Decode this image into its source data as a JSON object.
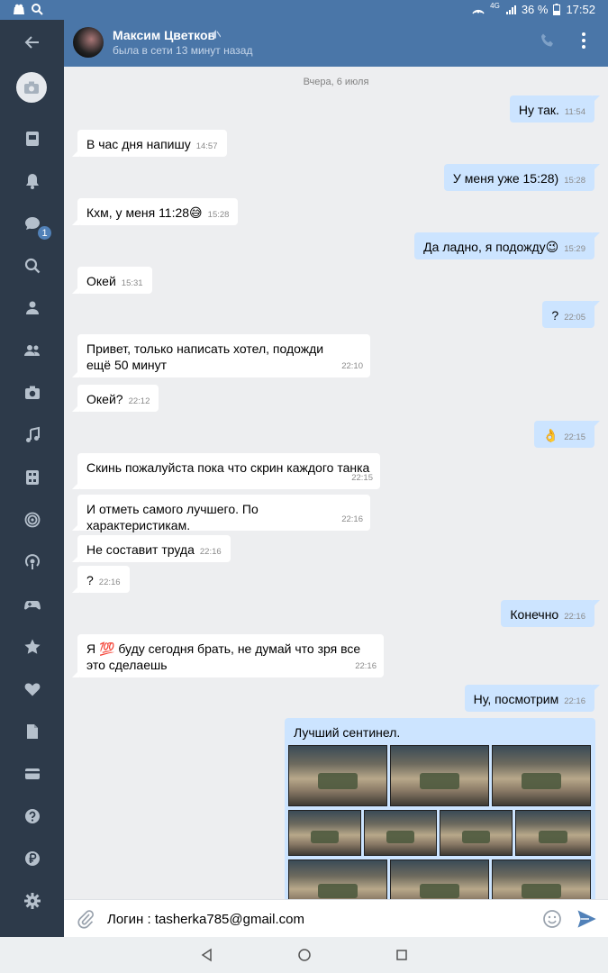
{
  "status_bar": {
    "battery": "36 %",
    "time": "17:52",
    "network": "4G"
  },
  "header": {
    "name": "Максим Цветков",
    "status": "была в сети 13 минут назад"
  },
  "sidebar": {
    "unread_badge": "1"
  },
  "chat": {
    "date_separator": "Вчера, 6 июля",
    "messages": [
      {
        "dir": "out",
        "text": "Ну так.",
        "time": "11:54"
      },
      {
        "dir": "in",
        "text": "В час дня напишу",
        "time": "14:57"
      },
      {
        "dir": "out",
        "text": "У меня уже 15:28)",
        "time": "15:28"
      },
      {
        "dir": "in",
        "text": "Кхм, у меня 11:28😅",
        "time": "15:28"
      },
      {
        "dir": "out",
        "text": "Да ладно, я подожду😉",
        "time": "15:29"
      },
      {
        "dir": "in",
        "text": "Окей",
        "time": "15:31"
      },
      {
        "dir": "out",
        "text": "?",
        "time": "22:05"
      },
      {
        "dir": "in",
        "text": "Привет, только написать хотел, подожди ещё 50 минут",
        "time": "22:10"
      },
      {
        "dir": "in",
        "text": "Окей?",
        "time": "22:12"
      },
      {
        "dir": "out",
        "text": "👌",
        "time": "22:15"
      },
      {
        "dir": "in",
        "text": "Скинь пожалуйста пока что скрин каждого танка",
        "time": "22:15"
      },
      {
        "dir": "in",
        "text": "И отметь самого лучшего. По характеристикам.",
        "time": "22:16"
      },
      {
        "dir": "in",
        "text": "Не составит труда",
        "time": "22:16"
      },
      {
        "dir": "in",
        "text": "?",
        "time": "22:16"
      },
      {
        "dir": "out",
        "text": "Конечно",
        "time": "22:16"
      },
      {
        "dir": "in",
        "text": "Я 💯 буду сегодня брать, не думай что зря все это сделаешь",
        "time": "22:16"
      },
      {
        "dir": "out",
        "text": "Ну, посмотрим",
        "time": "22:16"
      }
    ],
    "image_message": {
      "caption": "Лучший сентинел.",
      "image_count": 11
    }
  },
  "input": {
    "text": "Логин : tasherka785@gmail.com"
  },
  "colors": {
    "header": "#4a76a8",
    "sidebar": "#2d3a4a",
    "outgoing": "#cce4ff",
    "incoming": "#ffffff",
    "send": "#5181b8"
  }
}
